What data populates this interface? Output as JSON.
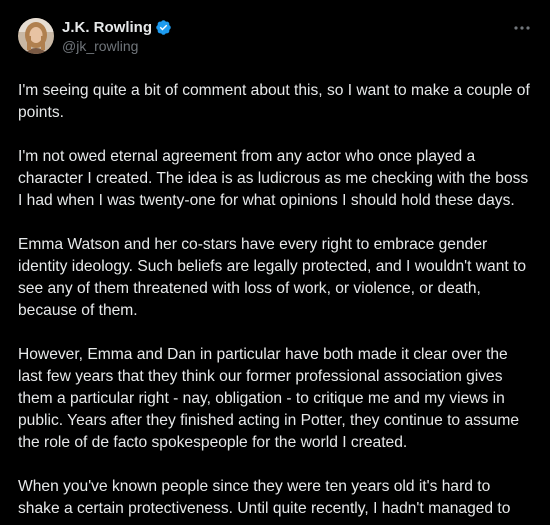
{
  "author": {
    "display_name": "J.K. Rowling",
    "handle": "@jk_rowling",
    "verified": true
  },
  "icons": {
    "verified": "verified-badge-icon",
    "more": "more-horizontal-icon"
  },
  "colors": {
    "background": "#000000",
    "text": "#e7e9ea",
    "secondary": "#71767b",
    "verified": "#1d9bf0"
  },
  "tweet": {
    "paragraphs": [
      "I'm seeing quite a bit of comment about this, so I want to make a couple of points.",
      "I'm not owed eternal agreement from any actor who once played a character I created. The idea is as ludicrous as me checking with the boss I had when I was twenty-one for what opinions I should hold these days.",
      "Emma Watson and her co-stars have every right to embrace gender identity ideology. Such beliefs are legally protected, and I wouldn't want to see any of them threatened with loss of work, or violence, or death, because of them.",
      "However, Emma and Dan in particular have both made it clear over the last few years that they think our former professional association gives them a particular right - nay, obligation - to critique me and my views in public. Years after they finished acting in Potter, they continue to assume the role of de facto spokespeople for the world I created.",
      "When you've known people since they were ten years old it's hard to shake a certain protectiveness. Until quite recently, I hadn't managed to"
    ]
  }
}
